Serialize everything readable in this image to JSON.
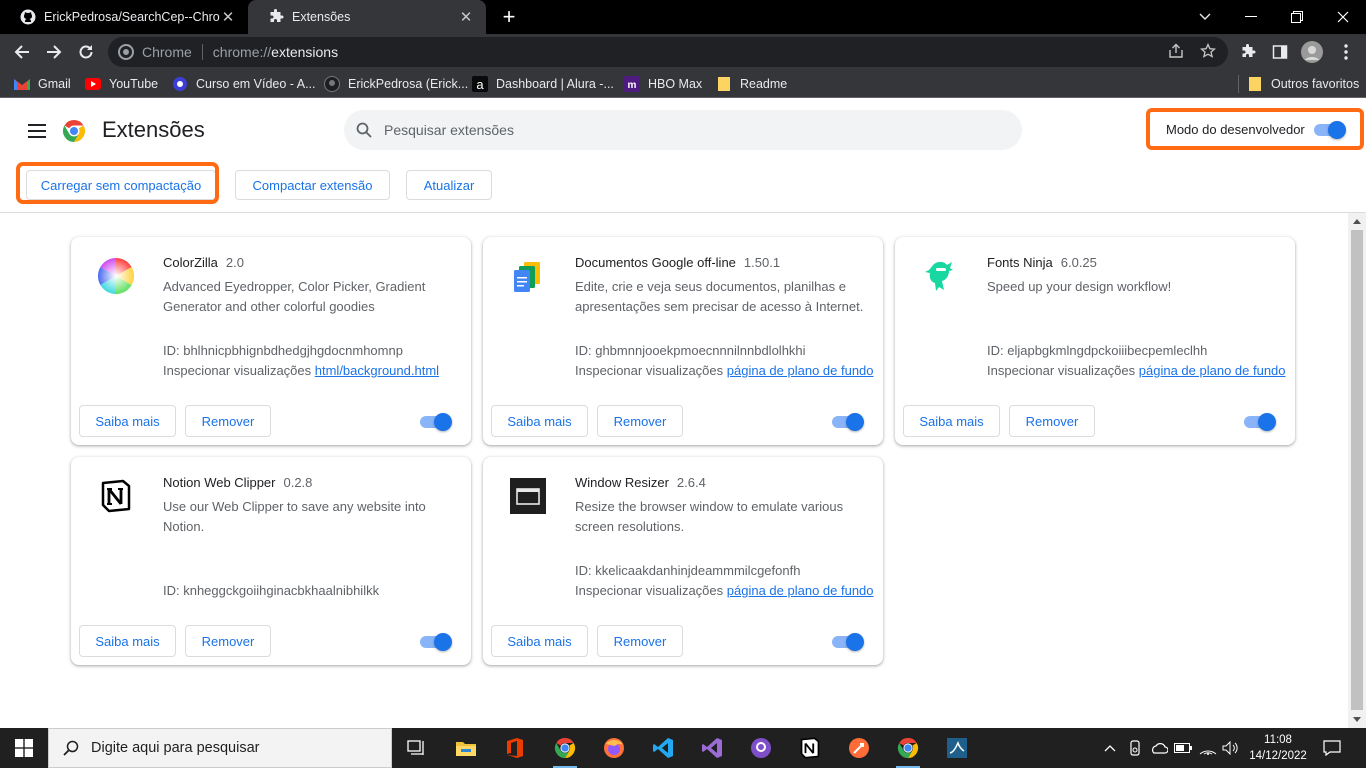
{
  "browser": {
    "tabs": [
      {
        "title": "ErickPedrosa/SearchCep--Chrome",
        "icon": "github-icon",
        "active": false
      },
      {
        "title": "Extensões",
        "icon": "puzzle-icon",
        "active": true
      }
    ],
    "omnibox": {
      "site_chip": "Chrome",
      "url_scheme": "chrome://",
      "url_host": "extensions"
    },
    "bookmarks": [
      {
        "label": "Gmail",
        "icon": "gmail-icon"
      },
      {
        "label": "YouTube",
        "icon": "youtube-icon"
      },
      {
        "label": "Curso em Vídeo - A...",
        "icon": "cursoemvideo-icon"
      },
      {
        "label": "ErickPedrosa (Erick...",
        "icon": "github-icon"
      },
      {
        "label": "Dashboard | Alura -...",
        "icon": "alura-icon"
      },
      {
        "label": "HBO Max",
        "icon": "hbomax-icon"
      },
      {
        "label": "Readme",
        "icon": "folder-icon"
      }
    ],
    "other_bookmarks": "Outros favoritos"
  },
  "page": {
    "title": "Extensões",
    "search_placeholder": "Pesquisar extensões",
    "dev_mode_label": "Modo do desenvolvedor",
    "dev_mode_on": true,
    "buttons": {
      "load_unpacked": "Carregar sem compactação",
      "pack": "Compactar extensão",
      "update": "Atualizar"
    }
  },
  "extensions": [
    {
      "name": "ColorZilla",
      "version": "2.0",
      "description": "Advanced Eyedropper, Color Picker, Gradient Generator and other colorful goodies",
      "id_text": "ID: bhlhnicpbhignbdhedgjhgdocnmhomnp",
      "inspect_label": "Inspecionar visualizações",
      "inspect_link": "html/background.html",
      "more": "Saiba mais",
      "remove": "Remover",
      "enabled": true,
      "icon": "colorzilla-icon"
    },
    {
      "name": "Documentos Google off-line",
      "version": "1.50.1",
      "description": "Edite, crie e veja seus documentos, planilhas e apresentações sem precisar de acesso à Internet.",
      "id_text": "ID: ghbmnnjooekpmoecnnnilnnbdlolhkhi",
      "inspect_label": "Inspecionar visualizações",
      "inspect_link": "página de plano de fundo",
      "more": "Saiba mais",
      "remove": "Remover",
      "enabled": true,
      "icon": "google-docs-icon"
    },
    {
      "name": "Fonts Ninja",
      "version": "6.0.25",
      "description": "Speed up your design workflow!",
      "id_text": "ID: eljapbgkmlngdpckoiiibecpemleclhh",
      "inspect_label": "Inspecionar visualizações",
      "inspect_link": "página de plano de fundo",
      "more": "Saiba mais",
      "remove": "Remover",
      "enabled": true,
      "icon": "fonts-ninja-icon"
    },
    {
      "name": "Notion Web Clipper",
      "version": "0.2.8",
      "description": "Use our Web Clipper to save any website into Notion.",
      "id_text": "ID: knheggckgoiihginacbkhaalnibhilkk",
      "inspect_label": "",
      "inspect_link": "",
      "more": "Saiba mais",
      "remove": "Remover",
      "enabled": true,
      "icon": "notion-icon"
    },
    {
      "name": "Window Resizer",
      "version": "2.6.4",
      "description": "Resize the browser window to emulate various screen resolutions.",
      "id_text": "ID: kkelicaakdanhinjdeammmilcgefonfh",
      "inspect_label": "Inspecionar visualizações",
      "inspect_link": "página de plano de fundo",
      "more": "Saiba mais",
      "remove": "Remover",
      "enabled": true,
      "icon": "window-resizer-icon"
    }
  ],
  "taskbar": {
    "search_placeholder": "Digite aqui para pesquisar",
    "apps": [
      "task-view-icon",
      "file-explorer-icon",
      "office-icon",
      "chrome-icon",
      "firefox-icon",
      "vscode-icon",
      "visual-studio-icon",
      "github-desktop-icon",
      "notion-icon",
      "postman-icon",
      "chrome-icon",
      "mysql-workbench-icon"
    ],
    "time": "11:08",
    "date": "14/12/2022"
  },
  "colors": {
    "accent": "#1a73e8",
    "highlight": "#ff6a13",
    "toggle_track": "#8ab4f8"
  }
}
